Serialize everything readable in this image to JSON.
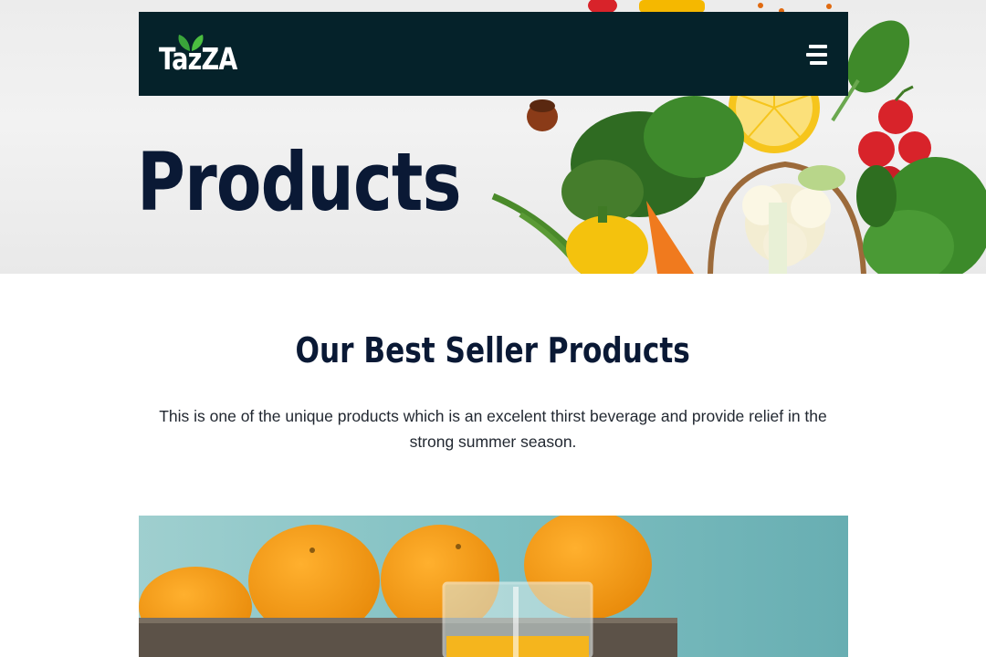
{
  "navbar": {
    "logo_text": "TazZA",
    "menu_icon": "hamburger-menu-icon"
  },
  "hero": {
    "title": "Products",
    "image": "fresh-vegetables-banner"
  },
  "best_seller": {
    "title": "Our Best Seller Products",
    "description": "This is one of the unique products which is an excelent thirst beverage and provide relief in the strong summer season."
  },
  "product_image": {
    "subject": "orange-juice-glass-with-oranges"
  },
  "colors": {
    "navbar_bg": "#05222a",
    "heading": "#0a1935",
    "body_text": "#222831",
    "logo_leaf": "#3aa53a"
  }
}
